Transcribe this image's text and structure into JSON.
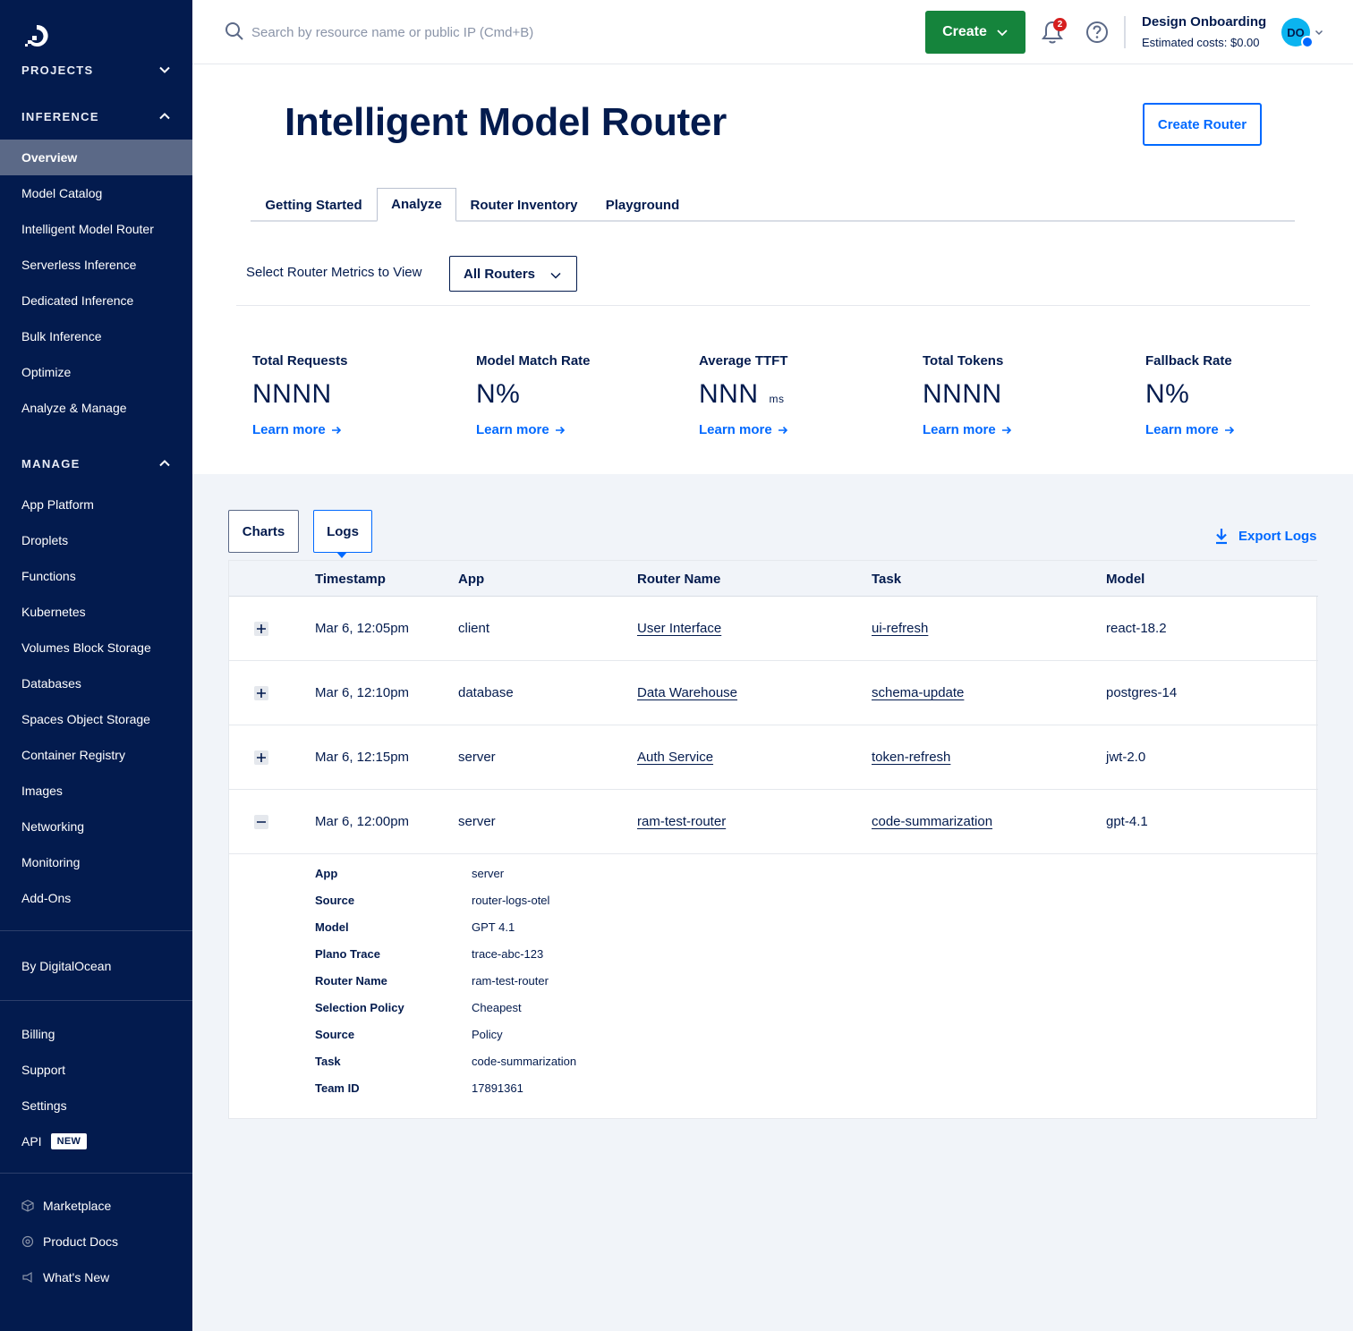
{
  "sidebar": {
    "projects_label": "PROJECTS",
    "inference_label": "INFERENCE",
    "inference_items": [
      "Overview",
      "Model Catalog",
      "Intelligent Model Router",
      "Serverless Inference",
      "Dedicated Inference",
      "Bulk Inference",
      "Optimize",
      "Analyze & Manage"
    ],
    "manage_label": "MANAGE",
    "manage_items": [
      "App Platform",
      "Droplets",
      "Functions",
      "Kubernetes",
      "Volumes Block Storage",
      "Databases",
      "Spaces Object Storage",
      "Container Registry",
      "Images",
      "Networking",
      "Monitoring",
      "Add-Ons"
    ],
    "by_do": "By DigitalOcean",
    "account_items": [
      "Billing",
      "Support",
      "Settings"
    ],
    "api_label": "API",
    "api_badge": "NEW",
    "footer_items": [
      "Marketplace",
      "Product Docs",
      "What's New"
    ]
  },
  "topbar": {
    "search_placeholder": "Search by resource name or public IP (Cmd+B)",
    "create_label": "Create",
    "notification_count": "2",
    "account_name": "Design Onboarding",
    "estimated_costs": "Estimated costs: $0.00",
    "avatar_initials": "DO"
  },
  "page": {
    "title": "Intelligent Model Router",
    "create_router_label": "Create Router",
    "tabs": [
      "Getting Started",
      "Analyze",
      "Router Inventory",
      "Playground"
    ],
    "active_tab": "Analyze",
    "select_label": "Select Router Metrics to View",
    "select_value": "All Routers"
  },
  "metrics": [
    {
      "label": "Total Requests",
      "value": "NNNN",
      "unit": "",
      "link": "Learn more"
    },
    {
      "label": "Model Match Rate",
      "value": "N%",
      "unit": "",
      "link": "Learn more"
    },
    {
      "label": "Average TTFT",
      "value": "NNN",
      "unit": "ms",
      "link": "Learn more"
    },
    {
      "label": "Total Tokens",
      "value": "NNNN",
      "unit": "",
      "link": "Learn more"
    },
    {
      "label": "Fallback Rate",
      "value": "N%",
      "unit": "",
      "link": "Learn more"
    }
  ],
  "view_tabs": [
    "Charts",
    "Logs"
  ],
  "export_label": "Export Logs",
  "table": {
    "columns": [
      "Timestamp",
      "App",
      "Router Name",
      "Task",
      "Model"
    ],
    "rows": [
      {
        "timestamp": "Mar 6, 12:05pm",
        "app": "client",
        "router": "User Interface",
        "task": "ui-refresh",
        "model": "react-18.2",
        "expanded": false
      },
      {
        "timestamp": "Mar 6, 12:10pm",
        "app": "database",
        "router": "Data Warehouse",
        "task": "schema-update",
        "model": "postgres-14",
        "expanded": false
      },
      {
        "timestamp": "Mar 6, 12:15pm",
        "app": "server",
        "router": "Auth Service",
        "task": "token-refresh",
        "model": "jwt-2.0",
        "expanded": false
      },
      {
        "timestamp": "Mar 6, 12:00pm",
        "app": "server",
        "router": "ram-test-router",
        "task": "code-summarization",
        "model": "gpt-4.1",
        "expanded": true
      }
    ],
    "details": [
      {
        "key": "App",
        "value": "server"
      },
      {
        "key": "Source",
        "value": "router-logs-otel"
      },
      {
        "key": "Model",
        "value": "GPT 4.1"
      },
      {
        "key": "Plano Trace",
        "value": "trace-abc-123"
      },
      {
        "key": "Router Name",
        "value": "ram-test-router"
      },
      {
        "key": "Selection Policy",
        "value": "Cheapest"
      },
      {
        "key": "Source",
        "value": "Policy"
      },
      {
        "key": "Task",
        "value": "code-summarization"
      },
      {
        "key": "Team ID",
        "value": "17891361"
      }
    ]
  },
  "colors": {
    "navy": "#031b4e",
    "brand_blue": "#0069ff",
    "create_green": "#15843c",
    "active_nav": "#5b6987",
    "page_bg": "#f1f4f9"
  }
}
